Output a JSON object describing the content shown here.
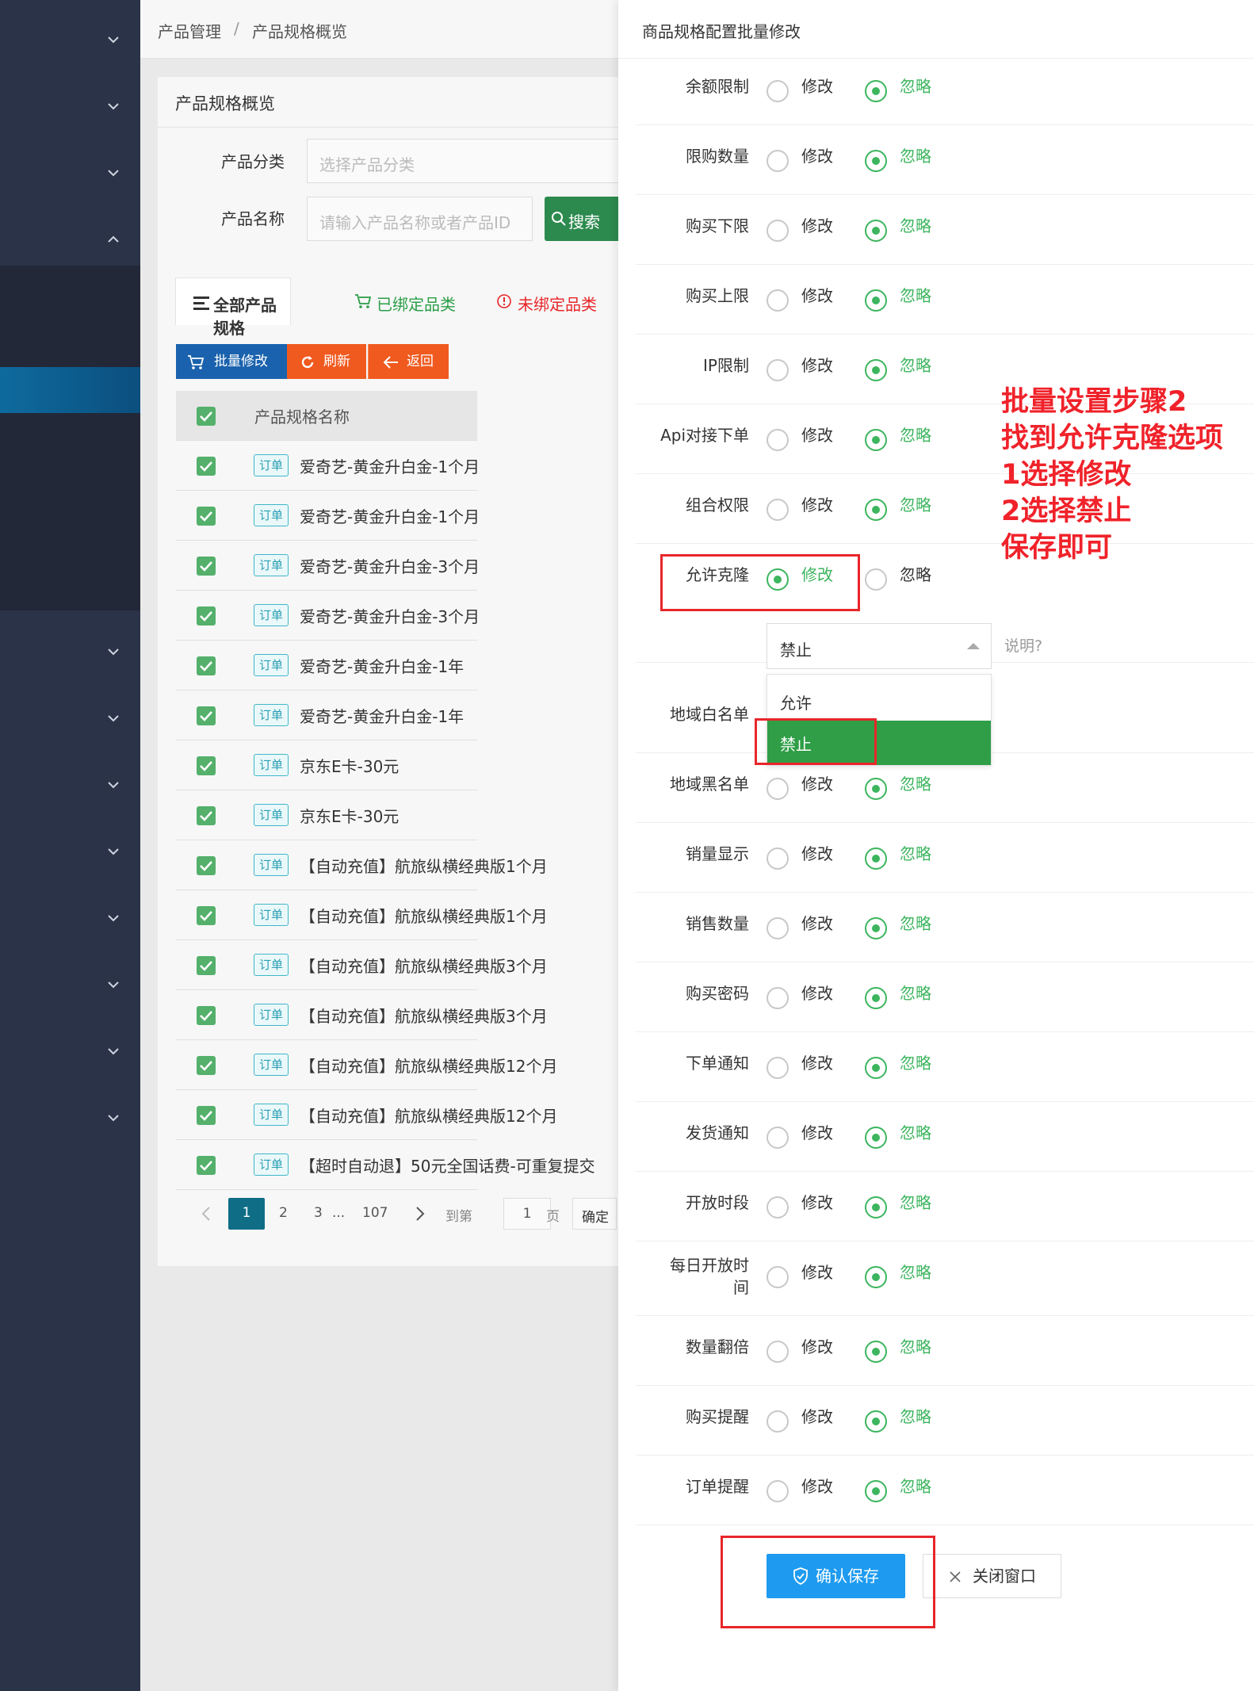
{
  "breadcrumb": {
    "item1": "产品管理",
    "sep": "/",
    "item2": "产品规格概览"
  },
  "card": {
    "title": "产品规格概览"
  },
  "filters": {
    "category_label": "产品分类",
    "category_placeholder": "选择产品分类",
    "name_label": "产品名称",
    "name_placeholder": "请输入产品名称或者产品ID",
    "search_label": "搜索"
  },
  "tabs": {
    "all": "全部产品规格",
    "bound": "已绑定品类",
    "unbound": "未绑定品类"
  },
  "actions": {
    "batch": "批量修改",
    "refresh": "刷新",
    "back": "返回"
  },
  "table": {
    "header": "产品规格名称",
    "tag": "订单",
    "rows": [
      "爱奇艺-黄金升白金-1个月",
      "爱奇艺-黄金升白金-1个月",
      "爱奇艺-黄金升白金-3个月",
      "爱奇艺-黄金升白金-3个月",
      "爱奇艺-黄金升白金-1年",
      "爱奇艺-黄金升白金-1年",
      "京东E卡-30元",
      "京东E卡-30元",
      "【自动充值】航旅纵横经典版1个月",
      "【自动充值】航旅纵横经典版1个月",
      "【自动充值】航旅纵横经典版3个月",
      "【自动充值】航旅纵横经典版3个月",
      "【自动充值】航旅纵横经典版12个月",
      "【自动充值】航旅纵横经典版12个月",
      "【超时自动退】50元全国话费-可重复提交"
    ]
  },
  "pager": {
    "p1": "1",
    "p2": "2",
    "p3": "3",
    "ellipsis": "...",
    "last": "107",
    "goto": "到第",
    "page_value": "1",
    "page_unit": "页",
    "confirm": "确定"
  },
  "panel": {
    "title": "商品规格配置批量修改",
    "opt_modify": "修改",
    "opt_ignore": "忽略",
    "rows": [
      {
        "label": "余额限制"
      },
      {
        "label": "限购数量"
      },
      {
        "label": "购买下限"
      },
      {
        "label": "购买上限"
      },
      {
        "label": "IP限制"
      },
      {
        "label": "Api对接下单"
      },
      {
        "label": "组合权限"
      },
      {
        "label": "允许克隆"
      },
      {
        "label": "地域白名单"
      },
      {
        "label": "地域黑名单"
      },
      {
        "label": "销量显示"
      },
      {
        "label": "销售数量"
      },
      {
        "label": "购买密码"
      },
      {
        "label": "下单通知"
      },
      {
        "label": "发货通知"
      },
      {
        "label": "开放时段"
      },
      {
        "label": "每日开放时间"
      },
      {
        "label": "数量翻倍"
      },
      {
        "label": "购买提醒"
      },
      {
        "label": "订单提醒"
      }
    ],
    "clone_select_value": "禁止",
    "explain": "说明?",
    "dropdown_options": [
      "允许",
      "禁止"
    ],
    "save": "确认保存",
    "close": "关闭窗口"
  },
  "annotation": {
    "line1": "批量设置步骤2",
    "line2": "找到允许克隆选项",
    "line3": "1选择修改",
    "line4": "2选择禁止",
    "line5": "保存即可"
  },
  "colors": {
    "accent": "#3cb55e",
    "annotation": "#f0222a",
    "save": "#1e9bf0",
    "sidebar": "#2b3348"
  }
}
